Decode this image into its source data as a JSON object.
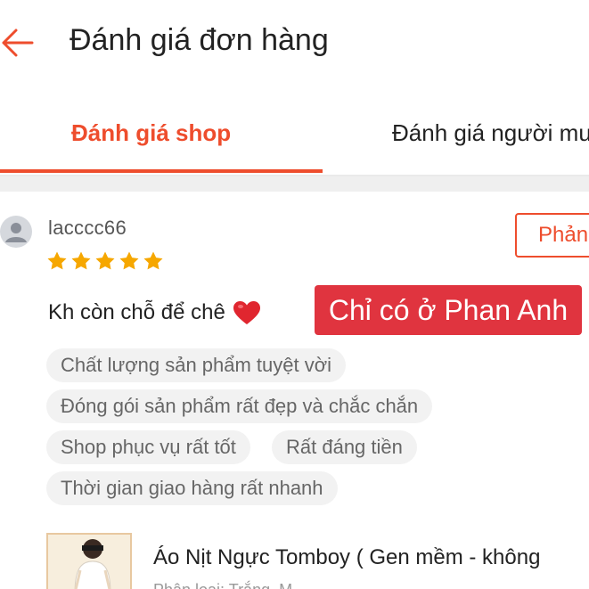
{
  "header": {
    "back_icon": "arrow-left-icon",
    "title": "Đánh giá đơn hàng"
  },
  "tabs": [
    {
      "label": "Đánh giá shop",
      "active": true
    },
    {
      "label": "Đánh giá người mu",
      "active": false
    }
  ],
  "review": {
    "avatar_icon": "user-avatar-icon",
    "username": "lacccc66",
    "rating": 5,
    "reply_label": "Phản",
    "comment": "Kh còn chỗ để chê",
    "comment_emoji": "heart-icon",
    "watermark": "Chỉ có ở Phan Anh",
    "tags": [
      "Chất lượng sản phẩm tuyệt vời",
      "Đóng gói sản phẩm rất đẹp và chắc chắn",
      "Shop phục vụ rất tốt",
      "Rất đáng tiền",
      "Thời gian giao hàng rất nhanh"
    ],
    "product": {
      "name": "Áo Nịt Ngực Tomboy ( Gen mềm - không",
      "variant": "Phân loại: Trắng, M"
    }
  },
  "colors": {
    "accent": "#ee4d2d",
    "star": "#f6a700",
    "watermark_bg": "#e0343f",
    "tag_bg": "#f2f2f2"
  }
}
